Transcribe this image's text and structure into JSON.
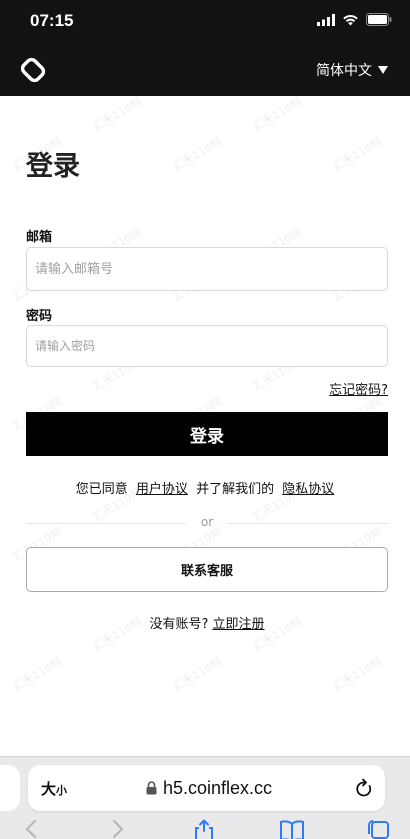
{
  "status_bar": {
    "time": "07:15"
  },
  "header": {
    "language": "简体中文"
  },
  "login": {
    "title": "登录",
    "email_label": "邮箱",
    "email_placeholder": "请输入邮箱号",
    "password_label": "密码",
    "password_placeholder": "请输入密码",
    "forgot_password": "忘记密码?",
    "login_button": "登录",
    "agree_prefix": "您已同意",
    "user_agreement": "用户协议",
    "agree_middle": "并了解我们的",
    "privacy_policy": "隐私协议",
    "or_text": "or",
    "contact_service": "联系客服",
    "no_account": "没有账号?",
    "register_now": "立即注册"
  },
  "watermark": {
    "text": "汇天110网"
  },
  "browser": {
    "text_size_label": "大",
    "text_size_small": "小",
    "url": "h5.coinflex.cc"
  },
  "colors": {
    "header_bg": "#121212",
    "button_bg": "#000000",
    "page_bg": "#ffffff",
    "toolbar_icon": "#2f7bf6"
  }
}
